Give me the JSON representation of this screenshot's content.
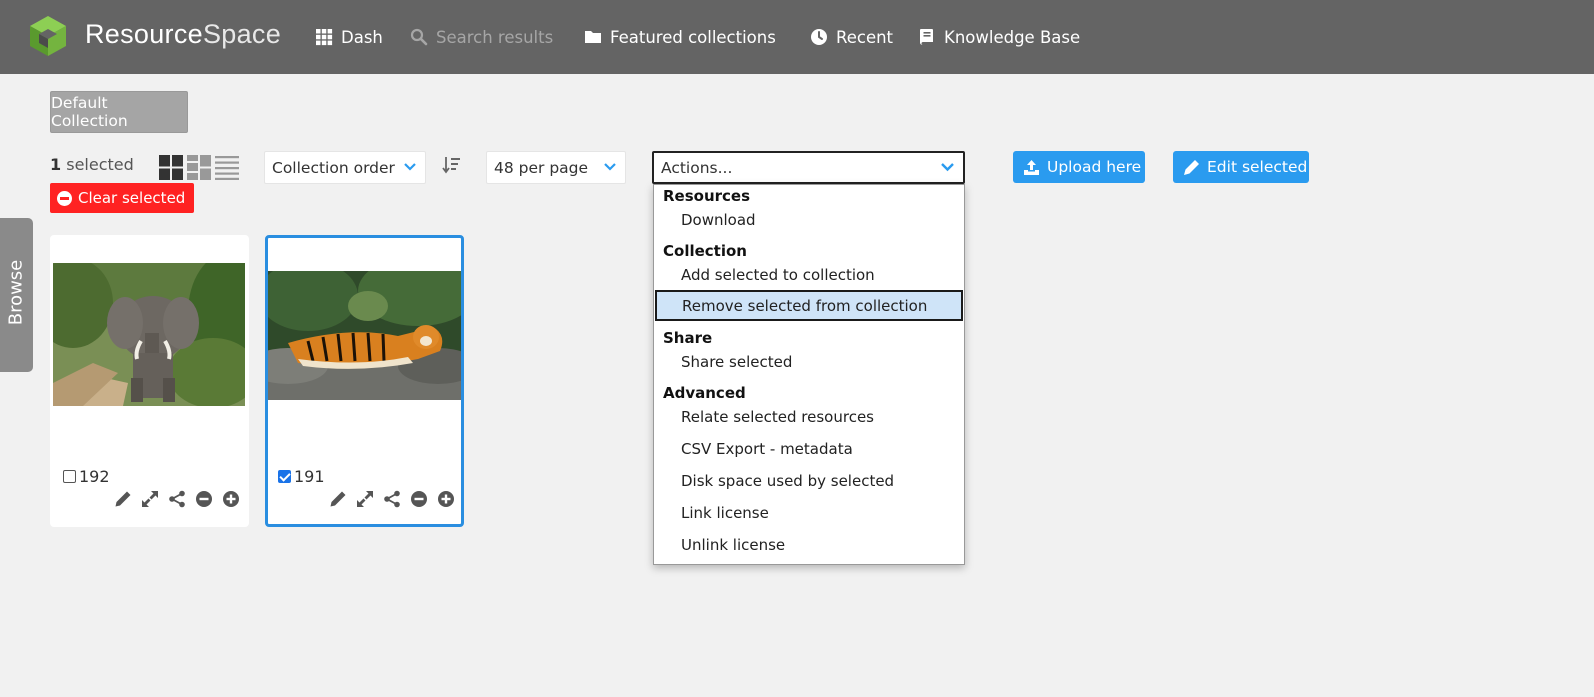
{
  "header": {
    "brand_bold": "Resource",
    "brand_light": "Space",
    "nav": [
      {
        "label": "Dash",
        "icon": "grid-icon",
        "state": "active"
      },
      {
        "label": "Search results",
        "icon": "search-icon",
        "state": "disabled"
      },
      {
        "label": "Featured collections",
        "icon": "folder-icon",
        "state": "active"
      },
      {
        "label": "Recent",
        "icon": "clock-icon",
        "state": "active"
      },
      {
        "label": "Knowledge Base",
        "icon": "book-icon",
        "state": "active"
      }
    ]
  },
  "toolbar": {
    "collection_button": "Default Collection",
    "selected_count": "1",
    "selected_suffix": " selected",
    "clear_selected": "Clear selected",
    "order_select": "Collection order",
    "per_page_select": "48 per page",
    "actions_select": "Actions...",
    "upload_button": "Upload here",
    "edit_button": "Edit selected"
  },
  "actions_menu": {
    "groups": [
      {
        "label": "Resources",
        "options": [
          "Download"
        ]
      },
      {
        "label": "Collection",
        "options": [
          "Add selected to collection",
          "Remove selected from collection"
        ]
      },
      {
        "label": "Share",
        "options": [
          "Share selected"
        ]
      },
      {
        "label": "Advanced",
        "options": [
          "Relate selected resources",
          "CSV Export - metadata",
          "Disk space used by selected",
          "Link license",
          "Unlink license"
        ]
      }
    ],
    "highlighted": "Remove selected from collection"
  },
  "browse_tab": "Browse",
  "resources": [
    {
      "id": "192",
      "checked": false,
      "image": "elephant"
    },
    {
      "id": "191",
      "checked": true,
      "image": "tiger"
    }
  ],
  "colors": {
    "header_bg": "#646464",
    "accent_blue": "#2a9bef",
    "danger_red": "#ff2222",
    "logo_green": "#74b43f"
  }
}
